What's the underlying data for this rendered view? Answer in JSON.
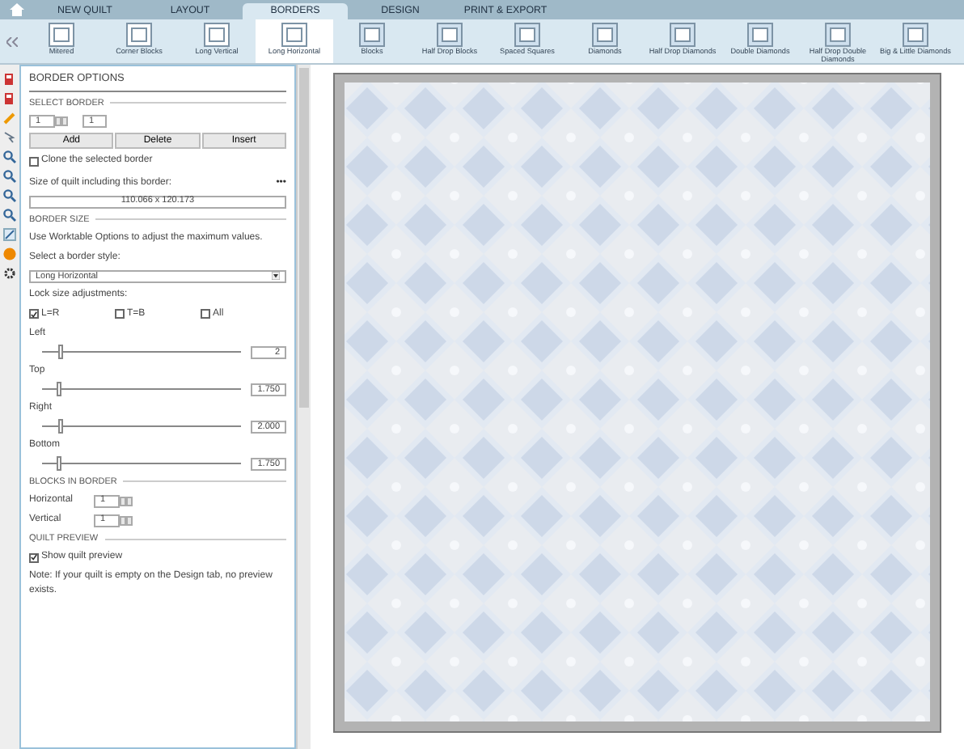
{
  "tabs": [
    {
      "label": "NEW QUILT",
      "selected": false
    },
    {
      "label": "LAYOUT",
      "selected": false
    },
    {
      "label": "BORDERS",
      "selected": true
    },
    {
      "label": "DESIGN",
      "selected": false
    },
    {
      "label": "PRINT & EXPORT",
      "selected": false
    }
  ],
  "border_styles": [
    {
      "label": "Mitered",
      "selected": false
    },
    {
      "label": "Corner Blocks",
      "selected": false
    },
    {
      "label": "Long Vertical",
      "selected": false
    },
    {
      "label": "Long Horizontal",
      "selected": true
    },
    {
      "label": "Blocks",
      "selected": false
    },
    {
      "label": "Half Drop Blocks",
      "selected": false
    },
    {
      "label": "Spaced Squares",
      "selected": false
    },
    {
      "label": "Diamonds",
      "selected": false
    },
    {
      "label": "Half Drop Diamonds",
      "selected": false
    },
    {
      "label": "Double Diamonds",
      "selected": false
    },
    {
      "label": "Half Drop Double Diamonds",
      "selected": false
    },
    {
      "label": "Big & Little Diamonds",
      "selected": false
    }
  ],
  "panel": {
    "title": "BORDER OPTIONS",
    "select_border": {
      "heading": "SELECT BORDER",
      "spinner_value": "1",
      "count_value": "1",
      "buttons": [
        "Add",
        "Delete",
        "Insert"
      ],
      "clone": {
        "label": "Clone the selected border",
        "checked": false
      },
      "size_label": "Size of quilt including this border:",
      "more": "•••",
      "size_value": "110.066 x 120.173"
    },
    "border_size": {
      "heading": "BORDER SIZE",
      "note": "Use Worktable Options to adjust the maximum values.",
      "style_label": "Select a border style:",
      "style_value": "Long Horizontal",
      "lock_label": "Lock size adjustments:",
      "locks": [
        {
          "label": "L=R",
          "checked": true
        },
        {
          "label": "T=B",
          "checked": false
        },
        {
          "label": "All",
          "checked": false
        }
      ],
      "sliders": [
        {
          "label": "Left",
          "level": 0.1,
          "value": "2"
        },
        {
          "label": "Top",
          "level": 0.09,
          "value": "1.750"
        },
        {
          "label": "Right",
          "level": 0.1,
          "value": "2.000"
        },
        {
          "label": "Bottom",
          "level": 0.09,
          "value": "1.750"
        }
      ]
    },
    "blocks_in_border": {
      "heading": "BLOCKS IN BORDER",
      "fields": [
        {
          "label": "Horizontal",
          "value": "1"
        },
        {
          "label": "Vertical",
          "value": "1"
        }
      ]
    },
    "quilt_preview": {
      "heading": "QUILT PREVIEW",
      "show": {
        "label": "Show quilt preview",
        "checked": true
      },
      "note": "Note: If your quilt is empty on the Design tab, no preview exists."
    }
  }
}
